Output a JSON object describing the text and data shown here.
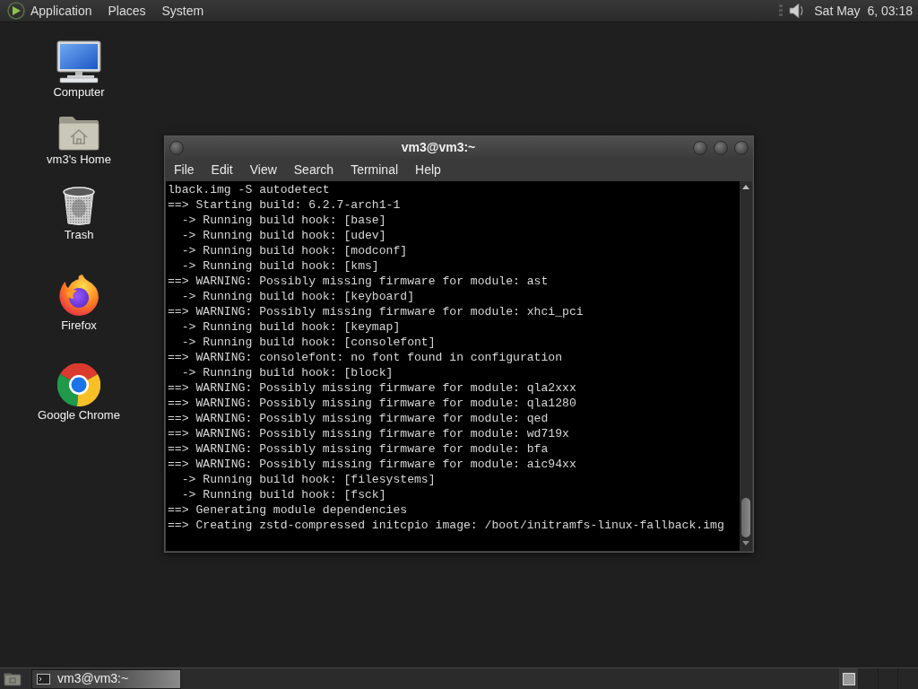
{
  "top_panel": {
    "menus": [
      {
        "label": "Application"
      },
      {
        "label": "Places"
      },
      {
        "label": "System"
      }
    ],
    "clock": "Sat May  6, 03:18"
  },
  "desktop_icons": [
    {
      "kind": "computer",
      "label": "Computer"
    },
    {
      "kind": "home",
      "label": "vm3's Home"
    },
    {
      "kind": "trash",
      "label": "Trash"
    },
    {
      "kind": "firefox",
      "label": "Firefox"
    },
    {
      "kind": "chrome",
      "label": "Google Chrome"
    }
  ],
  "terminal_window": {
    "title": "vm3@vm3:~",
    "menu": [
      "File",
      "Edit",
      "View",
      "Search",
      "Terminal",
      "Help"
    ],
    "lines": [
      "lback.img -S autodetect",
      "==> Starting build: 6.2.7-arch1-1",
      "  -> Running build hook: [base]",
      "  -> Running build hook: [udev]",
      "  -> Running build hook: [modconf]",
      "  -> Running build hook: [kms]",
      "==> WARNING: Possibly missing firmware for module: ast",
      "  -> Running build hook: [keyboard]",
      "==> WARNING: Possibly missing firmware for module: xhci_pci",
      "  -> Running build hook: [keymap]",
      "  -> Running build hook: [consolefont]",
      "==> WARNING: consolefont: no font found in configuration",
      "  -> Running build hook: [block]",
      "==> WARNING: Possibly missing firmware for module: qla2xxx",
      "==> WARNING: Possibly missing firmware for module: qla1280",
      "==> WARNING: Possibly missing firmware for module: qed",
      "==> WARNING: Possibly missing firmware for module: wd719x",
      "==> WARNING: Possibly missing firmware for module: bfa",
      "==> WARNING: Possibly missing firmware for module: aic94xx",
      "  -> Running build hook: [filesystems]",
      "  -> Running build hook: [fsck]",
      "==> Generating module dependencies",
      "==> Creating zstd-compressed initcpio image: /boot/initramfs-linux-fallback.img"
    ]
  },
  "bottom_panel": {
    "tasks": [
      {
        "label": "vm3@vm3:~",
        "selected": true
      }
    ]
  }
}
